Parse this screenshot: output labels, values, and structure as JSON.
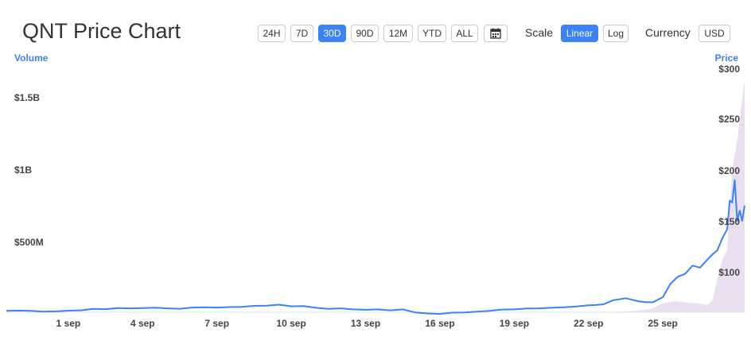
{
  "header": {
    "title": "QNT Price Chart",
    "ranges": [
      "24H",
      "7D",
      "30D",
      "90D",
      "12M",
      "YTD",
      "ALL"
    ],
    "active_range": "30D",
    "calendar_icon": "calendar-icon",
    "scale_label": "Scale",
    "scales": [
      "Linear",
      "Log"
    ],
    "active_scale": "Linear",
    "currency_label": "Currency",
    "currency_value": "USD"
  },
  "colors": {
    "accent": "#3b82f6",
    "price_line": "#3b82f6",
    "volume_fill": "#eadff0"
  },
  "chart_data": {
    "type": "line",
    "x_tick_labels": [
      "1 sep",
      "4 sep",
      "7 sep",
      "10 sep",
      "13 sep",
      "16 sep",
      "19 sep",
      "22 sep",
      "25 sep"
    ],
    "x_tick_days": [
      1,
      4,
      7,
      10,
      13,
      16,
      19,
      22,
      25
    ],
    "xlim": [
      -1.5,
      28.3
    ],
    "left_axis": {
      "title": "Volume",
      "tick_labels": [
        "$500M",
        "$1B",
        "$1.5B"
      ],
      "tick_values": [
        500,
        1000,
        1500
      ],
      "unit": "million USD"
    },
    "right_axis": {
      "title": "Price",
      "tick_labels": [
        "$100",
        "$150",
        "$200",
        "$250",
        "$300"
      ],
      "tick_values": [
        100,
        150,
        200,
        250,
        300
      ],
      "ylim": [
        60,
        305
      ]
    },
    "series": [
      {
        "name": "Price",
        "x": [
          -1.5,
          -1,
          -0.5,
          0,
          0.5,
          1,
          1.5,
          2,
          2.5,
          3,
          3.5,
          4,
          4.5,
          5,
          5.5,
          6,
          6.5,
          7,
          7.5,
          8,
          8.5,
          9,
          9.5,
          10,
          10.5,
          11,
          11.5,
          12,
          12.5,
          13,
          13.5,
          14,
          14.5,
          15,
          15.5,
          16,
          16.5,
          17,
          17.5,
          18,
          18.5,
          19,
          19.5,
          20,
          20.5,
          21,
          21.5,
          22,
          22.3,
          22.6,
          23,
          23.5,
          24,
          24.3,
          24.6,
          25,
          25.3,
          25.6,
          25.9,
          26.2,
          26.5,
          26.8,
          27,
          27.2,
          27.4,
          27.6,
          27.7,
          27.8,
          27.9,
          28,
          28.1,
          28.2,
          28.3
        ],
        "values": [
          61.5,
          61.8,
          61.6,
          60.8,
          61.0,
          61.7,
          62.0,
          63.5,
          63.2,
          64.2,
          64.0,
          64.3,
          64.6,
          64.0,
          63.6,
          64.8,
          65.0,
          64.8,
          65.2,
          65.4,
          66.4,
          66.6,
          67.6,
          66.0,
          66.2,
          64.5,
          63.4,
          64.0,
          63.0,
          62.6,
          63.0,
          62.0,
          63.0,
          60.0,
          59.0,
          58.5,
          59.8,
          60.0,
          60.8,
          61.5,
          62.8,
          63.0,
          63.8,
          64.0,
          64.5,
          65.0,
          65.8,
          67.0,
          67.3,
          68.0,
          72.0,
          74.0,
          71.0,
          70.0,
          70.0,
          75.0,
          88.0,
          95.0,
          98.0,
          106.0,
          104.0,
          112.0,
          117.0,
          121.0,
          133.0,
          142.0,
          170.0,
          168.0,
          190.0,
          150.0,
          160.0,
          150.0,
          165.0
        ]
      },
      {
        "name": "Volume",
        "x": [
          -1.5,
          0,
          5,
          10,
          15,
          20,
          23,
          24,
          24.5,
          25,
          25.5,
          26,
          26.4,
          26.8,
          27,
          27.2,
          27.4,
          27.6,
          27.8,
          28,
          28.3
        ],
        "values": [
          5,
          8,
          12,
          10,
          6,
          12,
          20,
          30,
          40,
          80,
          95,
          85,
          80,
          70,
          100,
          250,
          380,
          450,
          1000,
          1200,
          1620
        ]
      }
    ]
  }
}
